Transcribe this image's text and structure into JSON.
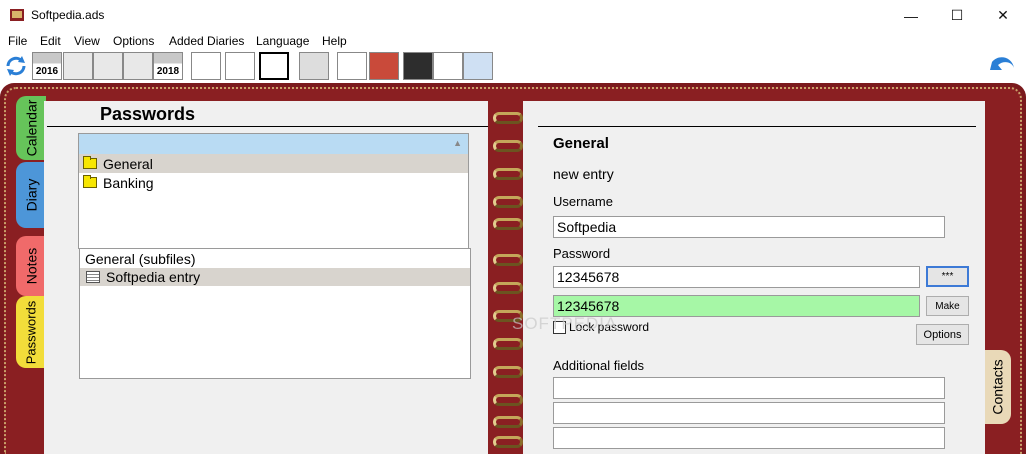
{
  "window": {
    "title": "Softpedia.ads"
  },
  "menu": [
    "File",
    "Edit",
    "View",
    "Options",
    "Added Diaries",
    "Language",
    "Help"
  ],
  "toolbar": {
    "year_prev": "2016",
    "year_next": "2018"
  },
  "tabs": {
    "calendar": "Calendar",
    "diary": "Diary",
    "notes": "Notes",
    "passwords": "Passwords",
    "contacts": "Contacts"
  },
  "left": {
    "title": "Passwords",
    "folders": [
      "General",
      "Banking"
    ],
    "subfiles_header": "General (subfiles)",
    "entries": [
      "Softpedia entry"
    ]
  },
  "right": {
    "title": "General",
    "entry_name": "new entry",
    "username_label": "Username",
    "username_value": "Softpedia",
    "password_label": "Password",
    "password_value": "12345678",
    "password_confirm": "12345678",
    "show_button": "***",
    "make_button": "Make",
    "lock_label": "Lock password",
    "options_button": "Options",
    "additional_label": "Additional fields",
    "watermark": "SOFTPEDIA"
  },
  "colors": {
    "binder": "#8a1f22",
    "page": "#f0f0f0",
    "selection": "#b9dbf3",
    "confirm_ok": "#a6f7a6"
  }
}
